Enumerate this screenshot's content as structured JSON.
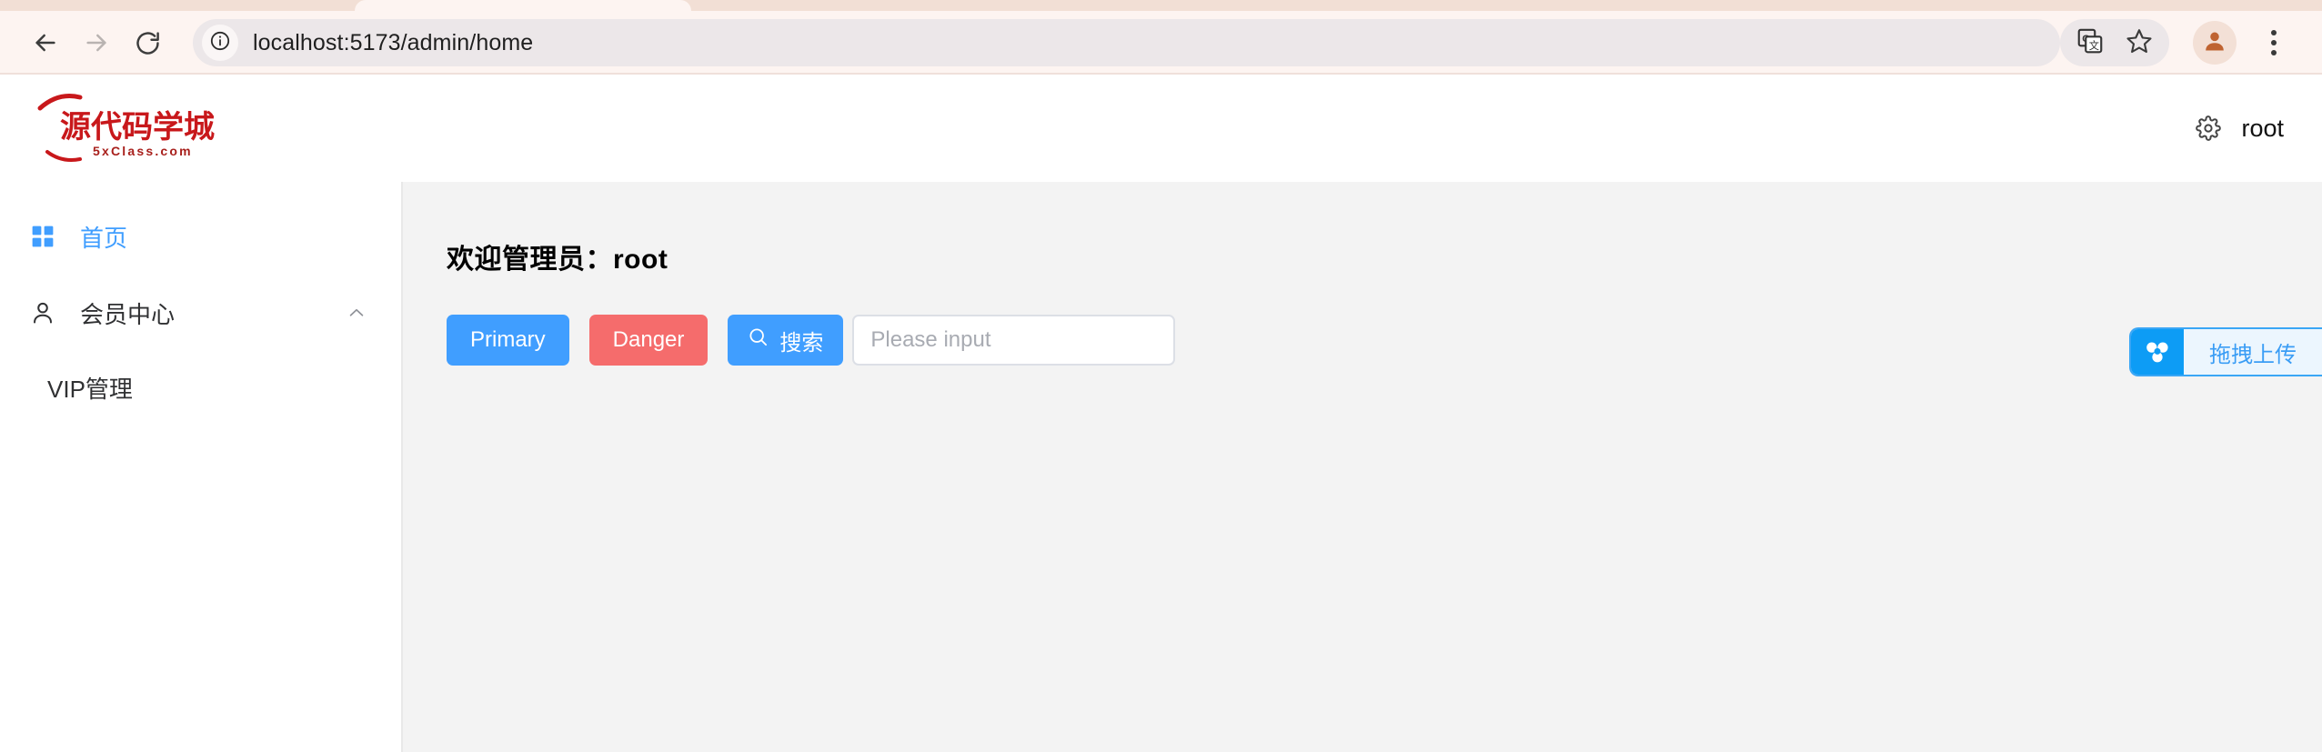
{
  "browser": {
    "url": "localhost:5173/admin/home",
    "back_label": "Back",
    "forward_label": "Forward",
    "reload_label": "Reload",
    "site_info_label": "View site information",
    "translate_label": "Translate this page",
    "bookmark_label": "Bookmark this tab",
    "profile_label": "Profile",
    "menu_label": "Customize and control Chrome",
    "icons": {
      "back": "back-arrow-icon",
      "forward": "forward-arrow-icon",
      "reload": "reload-icon",
      "site_info": "info-circle-icon",
      "translate": "translate-icon",
      "bookmark": "star-icon",
      "profile": "avatar-icon",
      "menu": "three-dot-menu-icon"
    }
  },
  "header": {
    "logo": {
      "title": "源代码学城",
      "subtitle": "5xClass.com",
      "color": "#c81e1e"
    },
    "user": {
      "name": "root",
      "settings_icon": "gear-icon"
    }
  },
  "sidebar": {
    "items": [
      {
        "label": "首页",
        "icon": "grid-icon",
        "active": true,
        "expandable": false
      },
      {
        "label": "会员中心",
        "icon": "user-icon",
        "active": false,
        "expandable": true,
        "expanded": true,
        "chevron": "chevron-up-icon",
        "children": [
          {
            "label": "VIP管理"
          }
        ]
      }
    ]
  },
  "main": {
    "welcome": "欢迎管理员：root",
    "buttons": {
      "primary": "Primary",
      "danger": "Danger",
      "search": "搜索",
      "search_icon": "search-icon"
    },
    "input": {
      "value": "",
      "placeholder": "Please input"
    }
  },
  "upload_widget": {
    "label": "拖拽上传",
    "icon": "baidu-netdisk-icon",
    "accent": "#0d9cf5"
  },
  "colors": {
    "primary": "#409eff",
    "danger": "#f56c6c",
    "content_bg": "#f3f3f3",
    "sidebar_bg": "#ffffff"
  }
}
